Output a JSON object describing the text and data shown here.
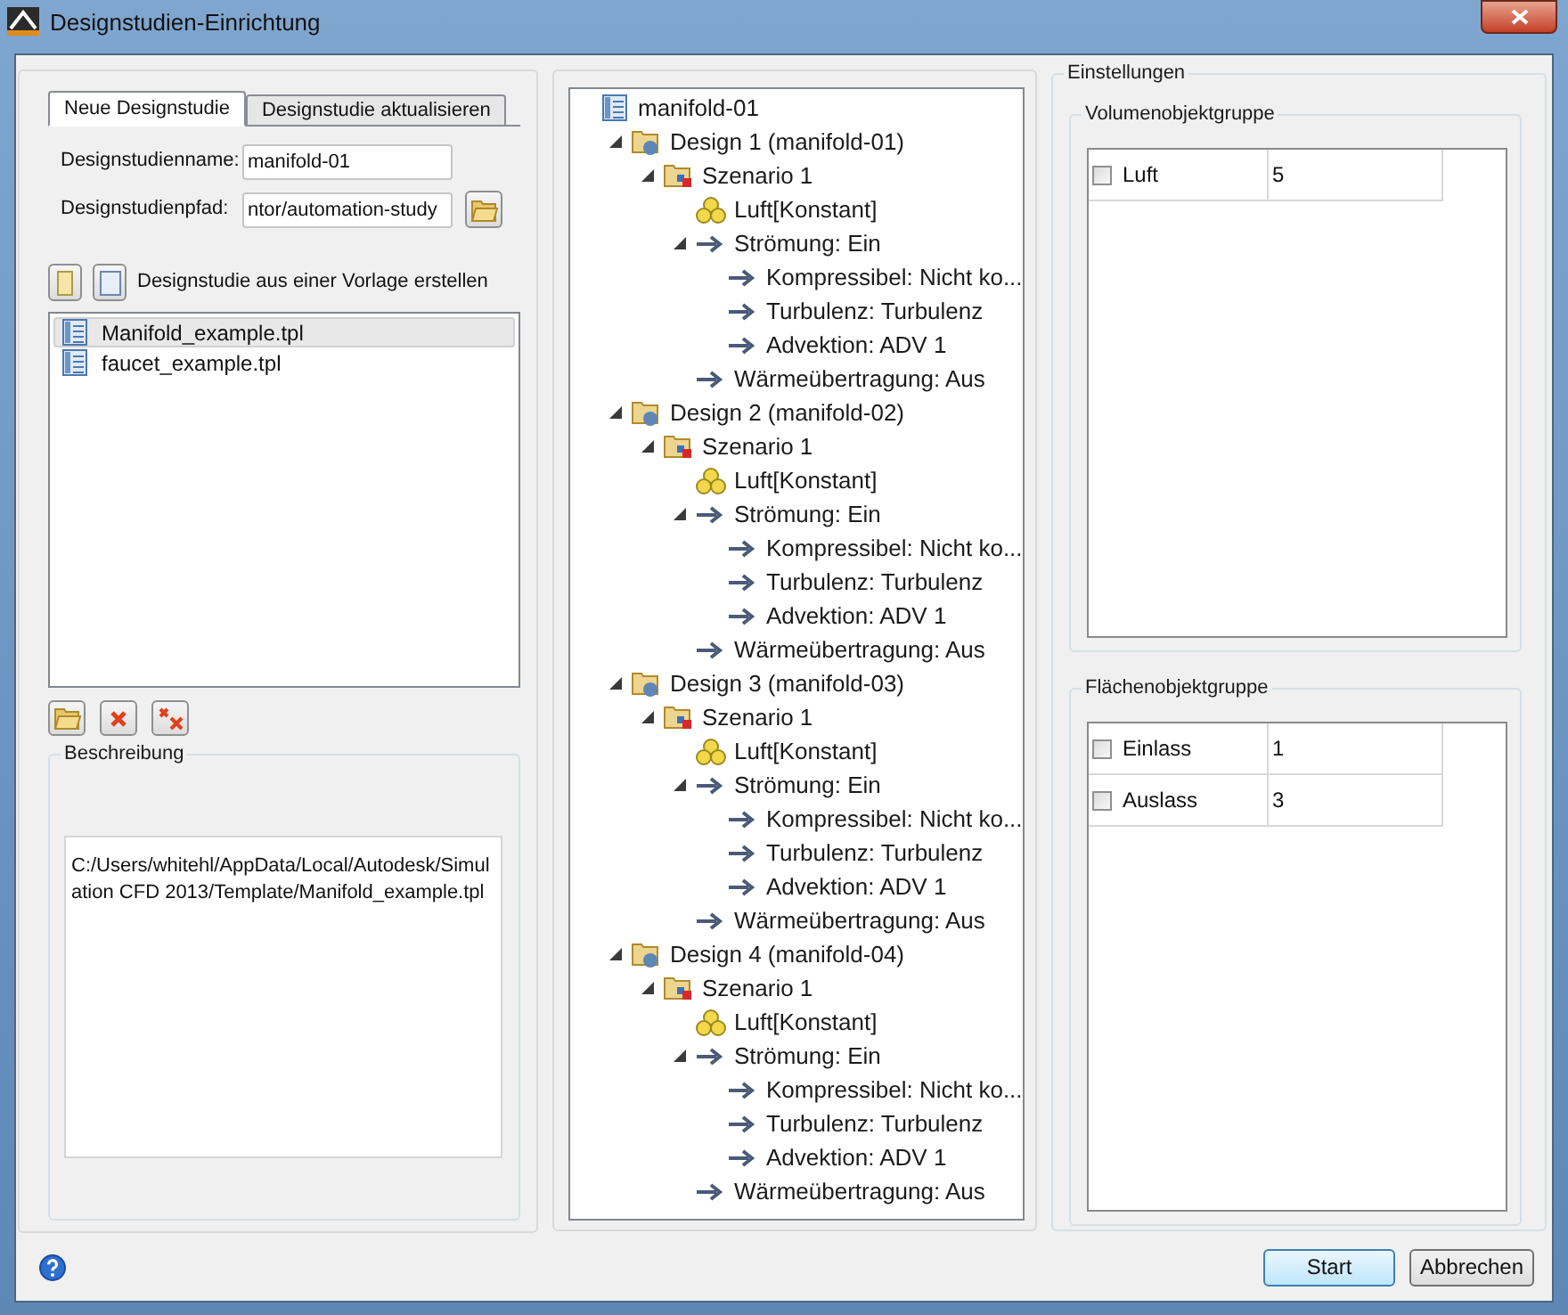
{
  "window": {
    "title": "Designstudien-Einrichtung"
  },
  "tabs": [
    {
      "label": "Neue Designstudie",
      "selected": true
    },
    {
      "label": "Designstudie aktualisieren",
      "selected": false
    }
  ],
  "fields": [
    {
      "label": "Designstudienname:",
      "value": "manifold-01",
      "kind": "text"
    },
    {
      "label": "Designstudienpfad:",
      "value": "ntor/automation-study",
      "kind": "path"
    }
  ],
  "template_toolbar": {
    "label": "Designstudie aus einer Vorlage erstellen"
  },
  "templates": [
    {
      "name": "Manifold_example.tpl",
      "selected": true
    },
    {
      "name": "faucet_example.tpl",
      "selected": false
    }
  ],
  "description": {
    "title": "Beschreibung",
    "text": "C:/Users/whitehl/AppData/Local/Autodesk/Simulation CFD 2013/Template/Manifold_example.tpl"
  },
  "tree": [
    {
      "label": "manifold-01",
      "kind": "study",
      "children": [
        {
          "label": "Design 1 (manifold-01)",
          "kind": "design",
          "expanded": true,
          "children": [
            {
              "label": "Szenario 1",
              "kind": "scenario",
              "expanded": true,
              "children": [
                {
                  "label": "Luft[Konstant]",
                  "kind": "material"
                },
                {
                  "label": "Strömung: Ein",
                  "kind": "setting",
                  "expanded": true,
                  "children": [
                    {
                      "label": "Kompressibel: Nicht ko...",
                      "kind": "setting"
                    },
                    {
                      "label": "Turbulenz: Turbulenz",
                      "kind": "setting"
                    },
                    {
                      "label": "Advektion: ADV 1",
                      "kind": "setting"
                    }
                  ]
                },
                {
                  "label": "Wärmeübertragung: Aus",
                  "kind": "setting"
                }
              ]
            }
          ]
        },
        {
          "label": "Design 2 (manifold-02)",
          "kind": "design",
          "expanded": true,
          "children": [
            {
              "label": "Szenario 1",
              "kind": "scenario",
              "expanded": true,
              "children": [
                {
                  "label": "Luft[Konstant]",
                  "kind": "material"
                },
                {
                  "label": "Strömung: Ein",
                  "kind": "setting",
                  "expanded": true,
                  "children": [
                    {
                      "label": "Kompressibel: Nicht ko...",
                      "kind": "setting"
                    },
                    {
                      "label": "Turbulenz: Turbulenz",
                      "kind": "setting"
                    },
                    {
                      "label": "Advektion: ADV 1",
                      "kind": "setting"
                    }
                  ]
                },
                {
                  "label": "Wärmeübertragung: Aus",
                  "kind": "setting"
                }
              ]
            }
          ]
        },
        {
          "label": "Design 3 (manifold-03)",
          "kind": "design",
          "expanded": true,
          "children": [
            {
              "label": "Szenario 1",
              "kind": "scenario",
              "expanded": true,
              "children": [
                {
                  "label": "Luft[Konstant]",
                  "kind": "material"
                },
                {
                  "label": "Strömung: Ein",
                  "kind": "setting",
                  "expanded": true,
                  "children": [
                    {
                      "label": "Kompressibel: Nicht ko...",
                      "kind": "setting"
                    },
                    {
                      "label": "Turbulenz: Turbulenz",
                      "kind": "setting"
                    },
                    {
                      "label": "Advektion: ADV 1",
                      "kind": "setting"
                    }
                  ]
                },
                {
                  "label": "Wärmeübertragung: Aus",
                  "kind": "setting"
                }
              ]
            }
          ]
        },
        {
          "label": "Design 4 (manifold-04)",
          "kind": "design",
          "expanded": true,
          "children": [
            {
              "label": "Szenario 1",
              "kind": "scenario",
              "expanded": true,
              "children": [
                {
                  "label": "Luft[Konstant]",
                  "kind": "material"
                },
                {
                  "label": "Strömung: Ein",
                  "kind": "setting",
                  "expanded": true,
                  "children": [
                    {
                      "label": "Kompressibel: Nicht ko...",
                      "kind": "setting"
                    },
                    {
                      "label": "Turbulenz: Turbulenz",
                      "kind": "setting"
                    },
                    {
                      "label": "Advektion: ADV 1",
                      "kind": "setting"
                    }
                  ]
                },
                {
                  "label": "Wärmeübertragung: Aus",
                  "kind": "setting"
                }
              ]
            }
          ]
        }
      ]
    }
  ],
  "settings": {
    "title": "Einstellungen",
    "groups": [
      {
        "title": "Volumenobjektgruppe",
        "rows": [
          {
            "name": "Luft",
            "value": "5",
            "checked": false
          }
        ]
      },
      {
        "title": "Flächenobjektgruppe",
        "rows": [
          {
            "name": "Einlass",
            "value": "1",
            "checked": false
          },
          {
            "name": "Auslass",
            "value": "3",
            "checked": false
          }
        ]
      }
    ]
  },
  "buttons": [
    {
      "label": "Start",
      "default": true
    },
    {
      "label": "Abbrechen",
      "default": false
    }
  ]
}
